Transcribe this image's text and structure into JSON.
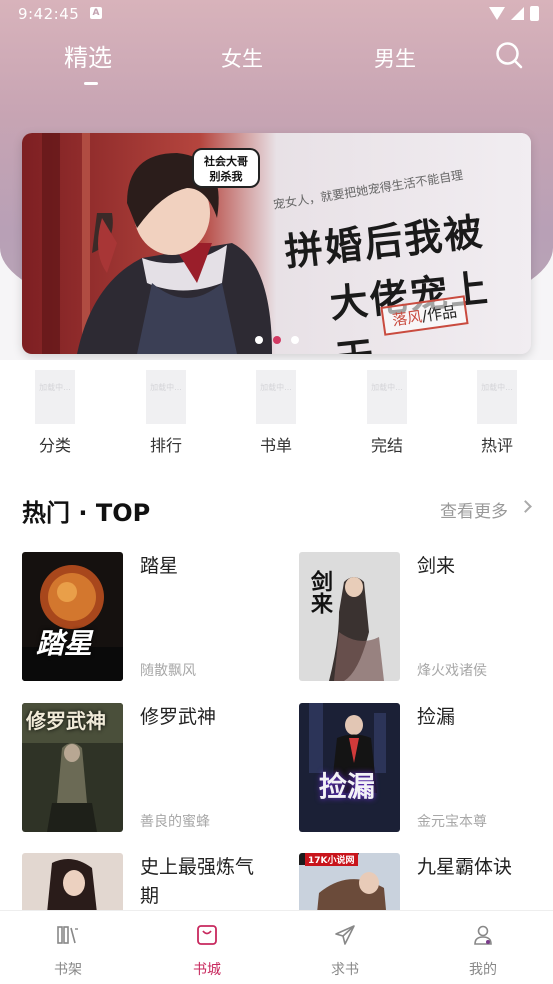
{
  "status_bar": {
    "time": "9:42:45",
    "a_badge": "A"
  },
  "top_tabs": [
    {
      "label": "精选",
      "active": true
    },
    {
      "label": "女生",
      "active": false
    },
    {
      "label": "男生",
      "active": false
    }
  ],
  "banner": {
    "title_line1": "拼婚后我被",
    "title_line2": "大佬宠上天",
    "tagline": "宠女人，就要把她宠得生活不能自理",
    "speech_bubble": "社会大哥\n别杀我",
    "author_name": "落风",
    "author_suffix": "/作品",
    "dots": 3,
    "active_dot": 1
  },
  "categories": [
    {
      "label": "分类",
      "placeholder": "加载中..."
    },
    {
      "label": "排行",
      "placeholder": "加载中..."
    },
    {
      "label": "书单",
      "placeholder": "加载中..."
    },
    {
      "label": "完结",
      "placeholder": "加载中..."
    },
    {
      "label": "热评",
      "placeholder": "加载中..."
    }
  ],
  "hot_section": {
    "title": "热门 · TOP",
    "more_label": "查看更多",
    "books": [
      {
        "name": "踏星",
        "author": "随散飘风",
        "cover_text": "踏星"
      },
      {
        "name": "剑来",
        "author": "烽火戏诸侯",
        "cover_text": "剑来"
      },
      {
        "name": "修罗武神",
        "author": "善良的蜜蜂",
        "cover_text": "修罗武神"
      },
      {
        "name": "捡漏",
        "author": "金元宝本尊",
        "cover_text": "捡漏"
      },
      {
        "name": "史上最强炼气期",
        "author": "",
        "cover_text": ""
      },
      {
        "name": "九星霸体诀",
        "author": "",
        "cover_text": "17K小说网"
      }
    ]
  },
  "bottom_nav": [
    {
      "label": "书架",
      "icon": "bookshelf-icon",
      "active": false
    },
    {
      "label": "书城",
      "icon": "bookstore-bag-icon",
      "active": true
    },
    {
      "label": "求书",
      "icon": "paper-plane-icon",
      "active": false
    },
    {
      "label": "我的",
      "icon": "user-icon",
      "active": false
    }
  ],
  "colors": {
    "accent": "#c8295e",
    "header_gradient_top": "#d8b3bb",
    "header_gradient_bottom": "#b8a6b6"
  }
}
